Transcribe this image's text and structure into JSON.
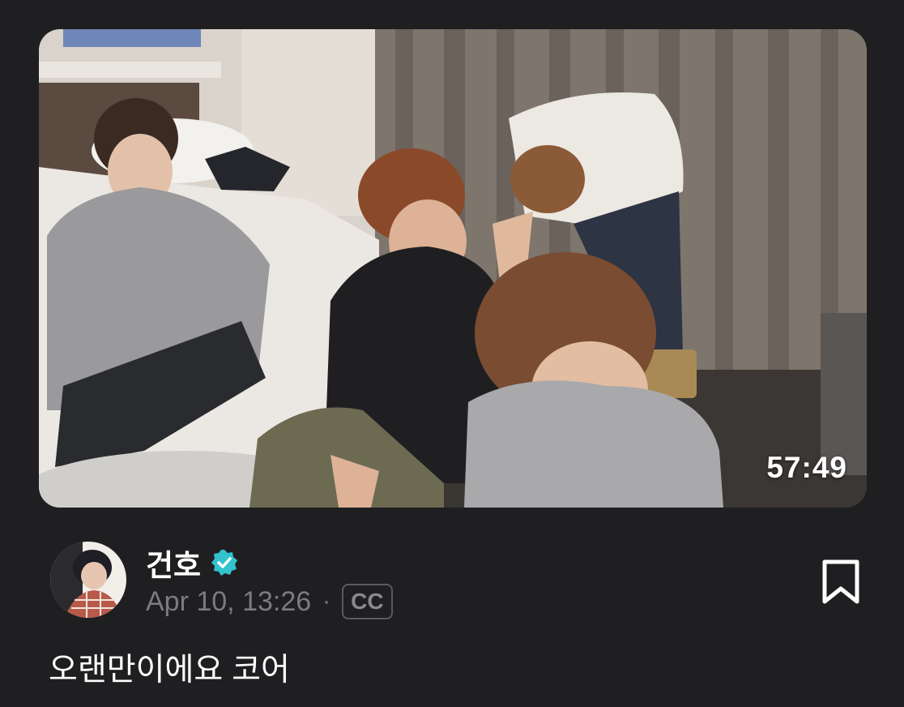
{
  "video": {
    "duration": "57:49"
  },
  "author": {
    "name": "건호",
    "verified_icon": "verified-badge-icon",
    "avatar_icon": "avatar-photo"
  },
  "post": {
    "timestamp": "Apr 10, 13:26",
    "separator": "·",
    "cc_label": "CC",
    "caption": "오랜만이에요 코어"
  },
  "actions": {
    "bookmark_icon": "bookmark-icon"
  },
  "colors": {
    "background": "#1f1f21",
    "verified": "#33c3cf",
    "muted_text": "#7b7b80"
  }
}
